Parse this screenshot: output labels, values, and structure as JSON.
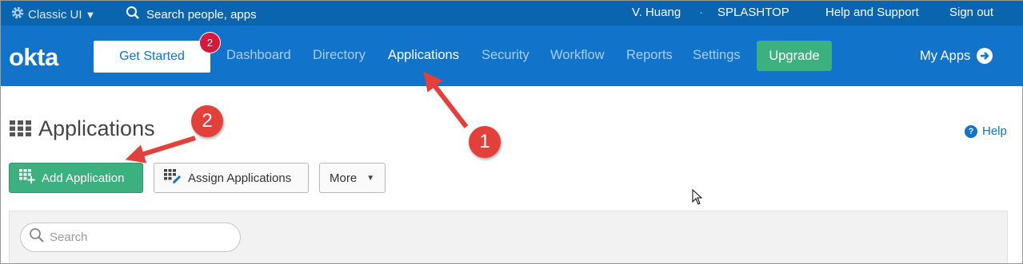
{
  "topbar": {
    "classic_ui": "Classic UI",
    "search_placeholder": "Search people, apps",
    "user": "V. Huang",
    "separator": "·",
    "org": "SPLASHTOP",
    "help_support": "Help and Support",
    "sign_out": "Sign out"
  },
  "nav": {
    "logo": "okta",
    "get_started": "Get Started",
    "get_started_badge": "2",
    "items": [
      "Dashboard",
      "Directory",
      "Applications",
      "Security",
      "Workflow",
      "Reports",
      "Settings"
    ],
    "active_item": "Applications",
    "upgrade": "Upgrade",
    "my_apps": "My Apps"
  },
  "page": {
    "title": "Applications",
    "help": "Help",
    "add_application": "Add Application",
    "assign_applications": "Assign Applications",
    "more": "More",
    "search_placeholder": "Search"
  },
  "annotations": {
    "step1": "1",
    "step2": "2",
    "color": "#e2403b"
  },
  "colors": {
    "topbar": "#0b64ae",
    "navbar": "#1173c9",
    "green": "#3cb07e",
    "badge": "#d5193a"
  }
}
